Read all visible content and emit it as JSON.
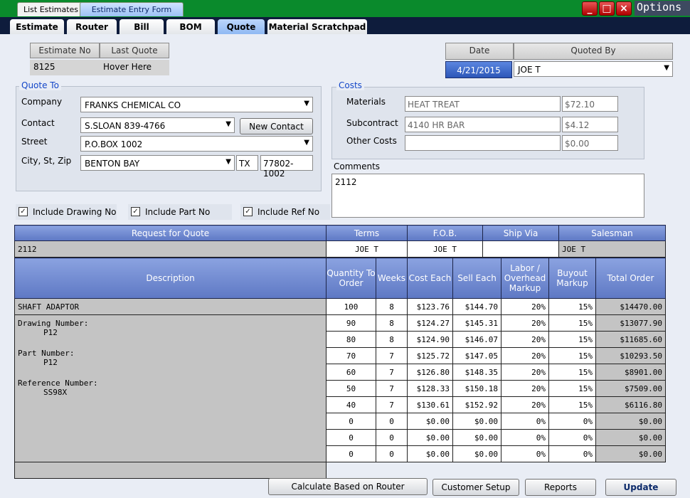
{
  "top_tabs": [
    "List Estimates",
    "Estimate Entry Form"
  ],
  "options_label": "Options",
  "tabs": [
    "Estimate",
    "Router",
    "Bill",
    "BOM",
    "Quote",
    "Material Scratchpad"
  ],
  "estimate": {
    "no_label": "Estimate No",
    "no_value": "8125",
    "last_quote_label": "Last Quote",
    "last_quote_value": "Hover Here"
  },
  "date_label": "Date",
  "date_value": "4/21/2015",
  "quoted_by_label": "Quoted By",
  "quoted_by_value": "JOE T",
  "quote_to": {
    "title": "Quote To",
    "company_label": "Company",
    "company_value": "FRANKS CHEMICAL CO",
    "contact_label": "Contact",
    "contact_value": "S.SLOAN 839-4766",
    "new_contact_label": "New Contact",
    "street_label": "Street",
    "street_value": "P.O.BOX 1002",
    "city_label": "City, St, Zip",
    "city_value": "BENTON BAY",
    "state_value": "TX",
    "zip_value": "77802-1002"
  },
  "costs": {
    "title": "Costs",
    "materials_label": "Materials",
    "materials_desc": "HEAT TREAT",
    "materials_amt": "$72.10",
    "subcontract_label": "Subcontract",
    "subcontract_desc": "4140 HR BAR",
    "subcontract_amt": "$4.12",
    "other_label": "Other Costs",
    "other_desc": "",
    "other_amt": "$0.00"
  },
  "comments_label": "Comments",
  "comments_value": "2112",
  "checks": [
    "Include Drawing No",
    "Include Part No",
    "Include Ref No"
  ],
  "rfq": {
    "headers": [
      "Request for Quote",
      "Terms",
      "F.O.B.",
      "Ship Via",
      "Salesman"
    ],
    "values": [
      "2112",
      "JOE T",
      "JOE T",
      "",
      "JOE T"
    ]
  },
  "grid_headers": [
    "Description",
    "Quantity To Order",
    "Weeks",
    "Cost Each",
    "Sell Each",
    "Labor / Overhead Markup",
    "Buyout Markup",
    "Total Order"
  ],
  "description": {
    "title": "SHAFT ADAPTOR",
    "drawing_label": "Drawing Number:",
    "drawing_value": "P12",
    "part_label": "Part Number:",
    "part_value": "P12",
    "ref_label": "Reference Number:",
    "ref_value": "SS98X"
  },
  "rows": [
    [
      "100",
      "8",
      "$123.76",
      "$144.70",
      "20%",
      "15%",
      "$14470.00"
    ],
    [
      "90",
      "8",
      "$124.27",
      "$145.31",
      "20%",
      "15%",
      "$13077.90"
    ],
    [
      "80",
      "8",
      "$124.90",
      "$146.07",
      "20%",
      "15%",
      "$11685.60"
    ],
    [
      "70",
      "7",
      "$125.72",
      "$147.05",
      "20%",
      "15%",
      "$10293.50"
    ],
    [
      "60",
      "7",
      "$126.80",
      "$148.35",
      "20%",
      "15%",
      "$8901.00"
    ],
    [
      "50",
      "7",
      "$128.33",
      "$150.18",
      "20%",
      "15%",
      "$7509.00"
    ],
    [
      "40",
      "7",
      "$130.61",
      "$152.92",
      "20%",
      "15%",
      "$6116.80"
    ],
    [
      "0",
      "0",
      "$0.00",
      "$0.00",
      "0%",
      "0%",
      "$0.00"
    ],
    [
      "0",
      "0",
      "$0.00",
      "$0.00",
      "0%",
      "0%",
      "$0.00"
    ],
    [
      "0",
      "0",
      "$0.00",
      "$0.00",
      "0%",
      "0%",
      "$0.00"
    ]
  ],
  "buttons": [
    "Calculate Based on Router",
    "Customer Setup",
    "Reports",
    "Update"
  ]
}
